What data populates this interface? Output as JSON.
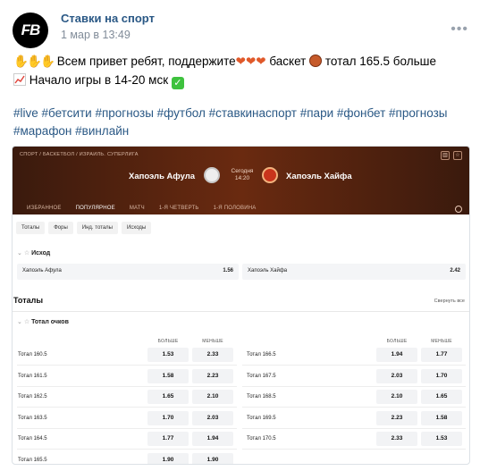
{
  "post": {
    "avatar_text": "FB",
    "author": "Ставки на спорт",
    "date": "1 мар в 13:49",
    "line1_text": "Всем привет ребят, поддержите",
    "line1_mid": "баскет",
    "line1_end": "тотал 165.5 больше",
    "line2_text": "Начало игры в 14-20 мск",
    "hashtags_line1": "#live #бетсити #прогнозы #футбол #ставкинаспорт #пари #фонбет #прогнозы",
    "hashtags_line2": "#марафон #винлайн",
    "icons": [
      "clap-hands-icon",
      "heart-icon",
      "basketball-icon",
      "chart-up-icon",
      "check-icon",
      "more-icon"
    ]
  },
  "screenshot": {
    "breadcrumb": "СПОРТ / БАСКЕТБОЛ / ИЗРАИЛЬ. СУПЕРЛИГА",
    "team_home": "Хапоэль Афула",
    "team_away": "Хапоэль Хайфа",
    "kickoff_day": "Сегодня",
    "kickoff_time": "14:20",
    "tabs": [
      "ИЗБРАННОЕ",
      "ПОПУЛЯРНОЕ",
      "МАТЧ",
      "1-Я ЧЕТВЕРТЬ",
      "1-Я ПОЛОВИНА"
    ],
    "filters": [
      "Тоталы",
      "Форы",
      "Инд. тоталы",
      "Исходы"
    ],
    "outcome_title": "Исход",
    "outcome": [
      {
        "label": "Хапоэль Афула",
        "odd": "1.56"
      },
      {
        "label": "Хапоэль Хайфа",
        "odd": "2.42"
      }
    ],
    "totals_title": "Тоталы",
    "collapse_all": "Свернуть все",
    "total_points_title": "Тотал очков",
    "col_over": "БОЛЬШЕ",
    "col_under": "МЕНЬШЕ",
    "left_rows": [
      {
        "label": "Тотал 160.5",
        "over": "1.53",
        "under": "2.33"
      },
      {
        "label": "Тотал 161.5",
        "over": "1.58",
        "under": "2.23"
      },
      {
        "label": "Тотал 162.5",
        "over": "1.65",
        "under": "2.10"
      },
      {
        "label": "Тотал 163.5",
        "over": "1.70",
        "under": "2.03"
      },
      {
        "label": "Тотал 164.5",
        "over": "1.77",
        "under": "1.94"
      },
      {
        "label": "Тотал 165.5",
        "over": "1.90",
        "under": "1.90"
      }
    ],
    "right_rows": [
      {
        "label": "Тотал 166.5",
        "over": "1.94",
        "under": "1.77"
      },
      {
        "label": "Тотал 167.5",
        "over": "2.03",
        "under": "1.70"
      },
      {
        "label": "Тотал 168.5",
        "over": "2.10",
        "under": "1.65"
      },
      {
        "label": "Тотал 169.5",
        "over": "2.23",
        "under": "1.58"
      },
      {
        "label": "Тотал 170.5",
        "over": "2.33",
        "under": "1.53"
      }
    ]
  }
}
